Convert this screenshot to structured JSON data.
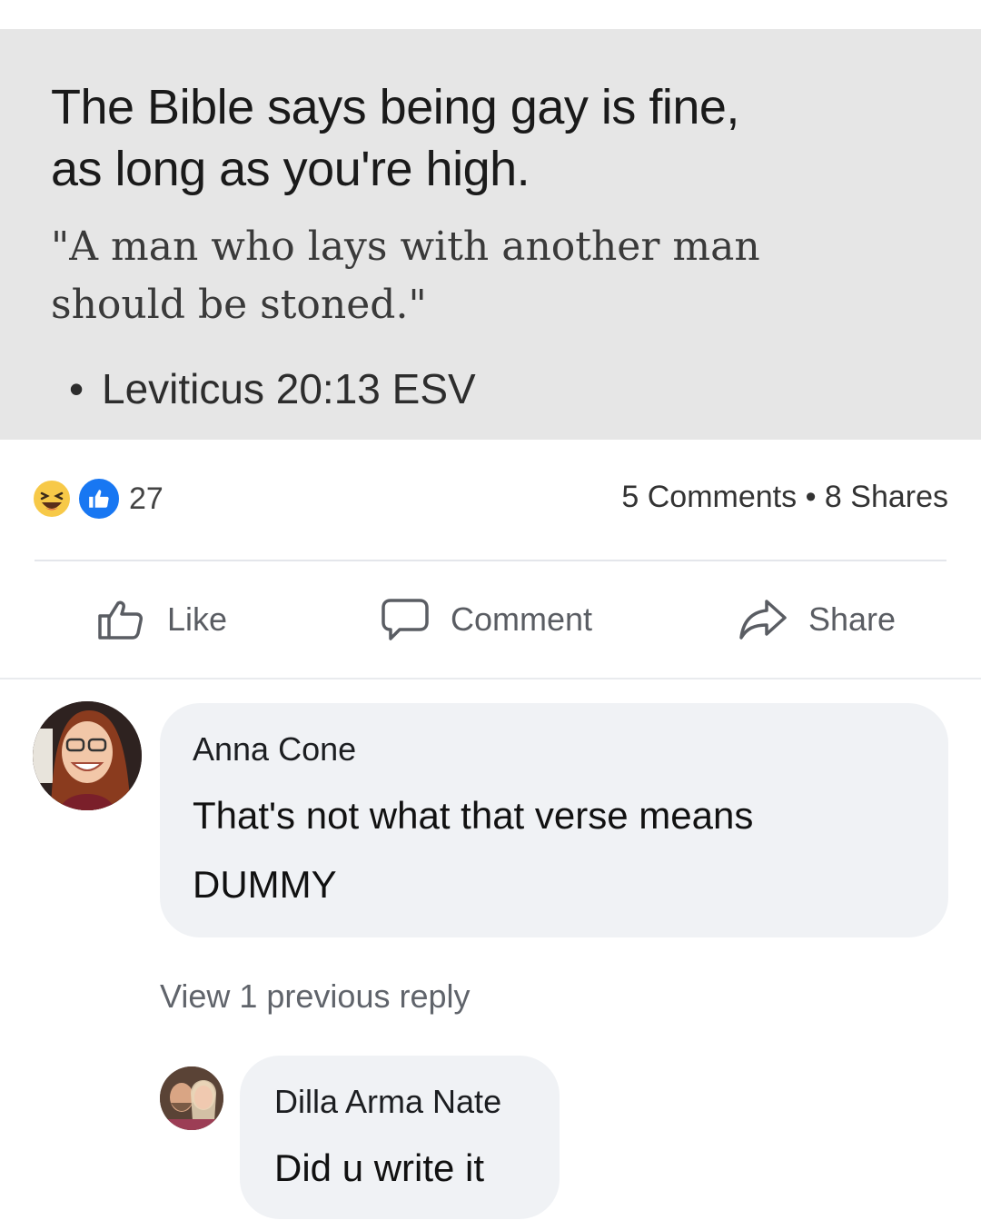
{
  "post": {
    "headline": "The Bible says being gay is fine,\nas long as you're high.",
    "quote": "\"A man who lays with another man\nshould be stoned.\"",
    "citation_bullet": "•",
    "citation": "Leviticus 20:13 ESV"
  },
  "reactions": {
    "icons": [
      "haha-icon",
      "like-icon"
    ],
    "count": "27",
    "comments_shares": "5 Comments • 8 Shares"
  },
  "actions": {
    "like_label": "Like",
    "comment_label": "Comment",
    "share_label": "Share"
  },
  "comments": [
    {
      "author": "Anna Cone",
      "text": "That's not what that verse means\nDUMMY"
    }
  ],
  "view_previous_label": "View 1 previous reply",
  "replies": [
    {
      "author": "Dilla Arma Nate",
      "text": "Did u write it"
    }
  ],
  "colors": {
    "quote_card_bg": "#e6e6e6",
    "like_blue": "#1877f2",
    "haha_yellow": "#f7c948",
    "bubble_bg": "#f0f2f5"
  }
}
